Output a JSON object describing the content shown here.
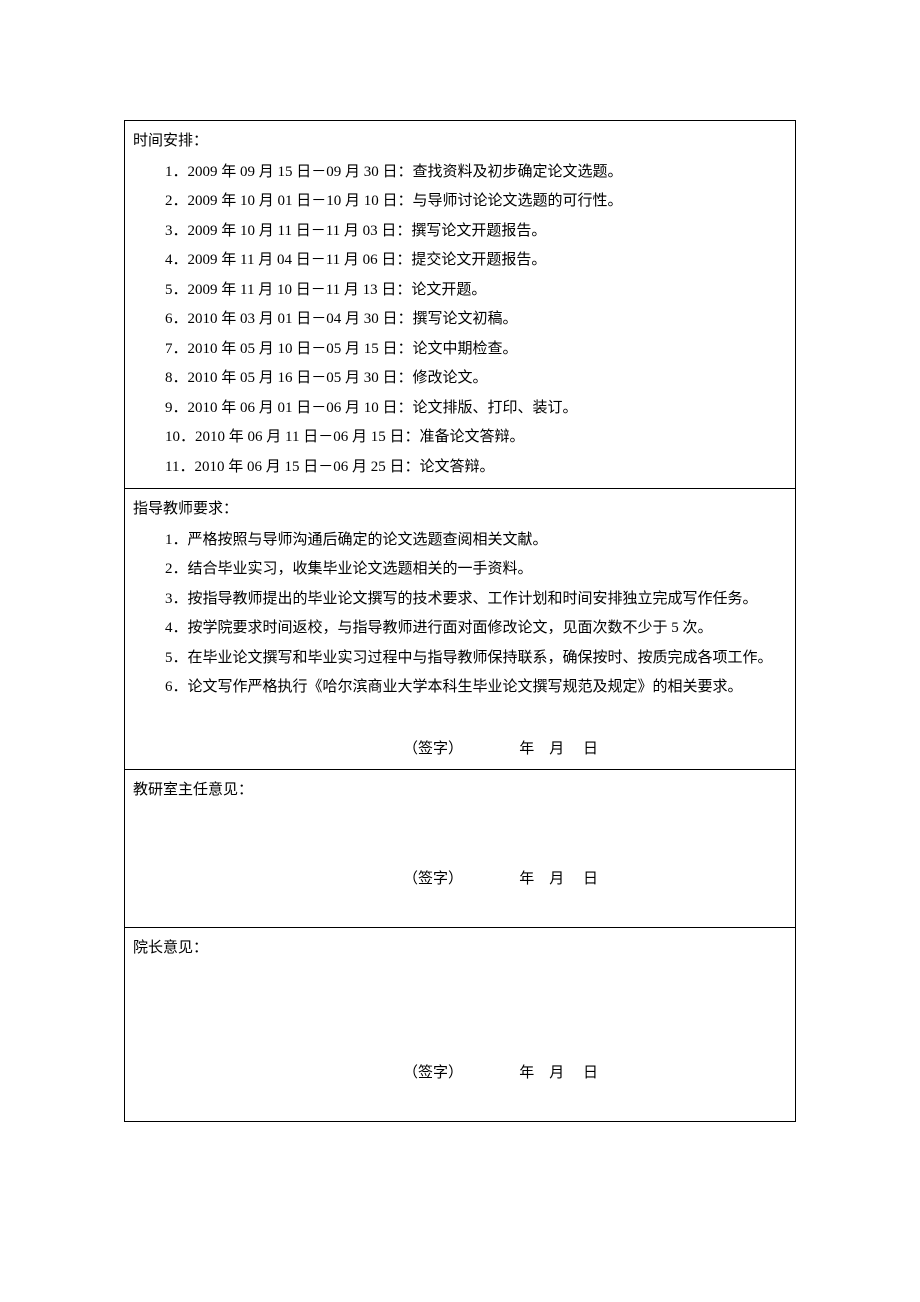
{
  "sections": {
    "schedule": {
      "heading": "时间安排：",
      "items": [
        "1．2009 年 09 月 15 日－09 月 30 日：查找资料及初步确定论文选题。",
        "2．2009 年 10 月 01 日－10 月 10 日：与导师讨论论文选题的可行性。",
        "3．2009 年 10 月 11 日－11 月 03 日：撰写论文开题报告。",
        "4．2009 年 11 月 04 日－11 月 06 日：提交论文开题报告。",
        "5．2009 年 11 月 10 日－11 月 13 日：论文开题。",
        "6．2010 年 03 月 01 日－04 月 30 日：撰写论文初稿。",
        "7．2010 年 05 月 10 日－05 月 15 日：论文中期检查。",
        "8．2010 年 05 月 16 日－05 月 30 日：修改论文。",
        "9．2010 年 06 月 01 日－06 月 10 日：论文排版、打印、装订。",
        "10．2010 年 06 月 11 日－06 月 15 日：准备论文答辩。",
        "11．2010 年 06 月 15 日－06 月 25 日：论文答辩。"
      ]
    },
    "advisor": {
      "heading": "指导教师要求：",
      "items": [
        "1．严格按照与导师沟通后确定的论文选题查阅相关文献。",
        "2．结合毕业实习，收集毕业论文选题相关的一手资料。",
        "3．按指导教师提出的毕业论文撰写的技术要求、工作计划和时间安排独立完成写作任务。",
        "4．按学院要求时间返校，与指导教师进行面对面修改论文，见面次数不少于 5 次。",
        "5．在毕业论文撰写和毕业实习过程中与指导教师保持联系，确保按时、按质完成各项工作。",
        "6．论文写作严格执行《哈尔滨商业大学本科生毕业论文撰写规范及规定》的相关要求。"
      ],
      "signature_line": "（签字）               年    月     日"
    },
    "office_director": {
      "heading": "教研室主任意见：",
      "signature_line": "（签字）               年    月     日"
    },
    "dean": {
      "heading": "院长意见：",
      "signature_line": "（签字）               年    月     日"
    }
  }
}
